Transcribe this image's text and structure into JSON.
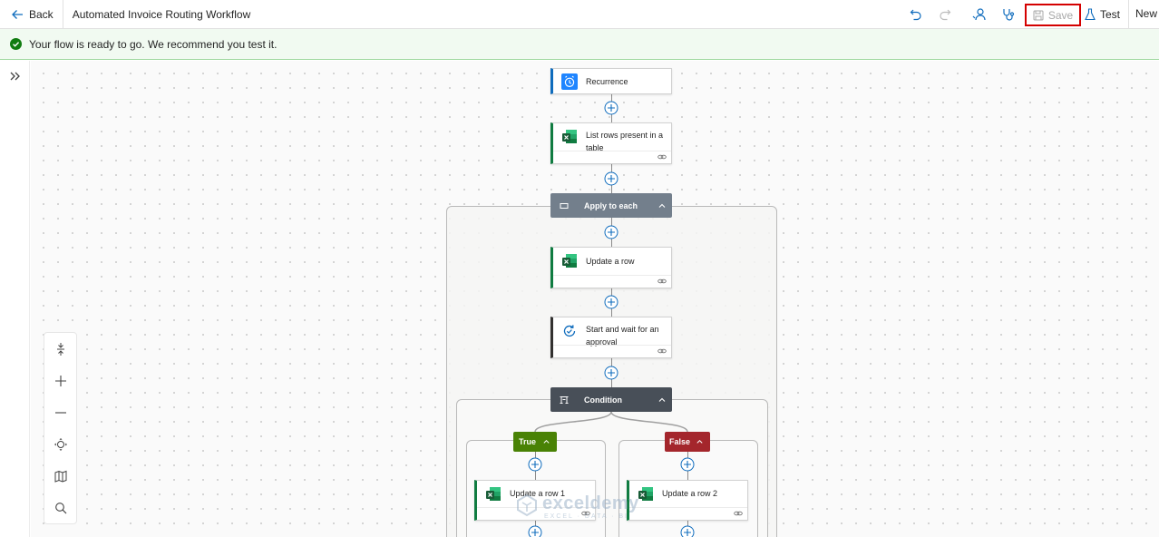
{
  "topbar": {
    "back_label": "Back",
    "flow_title": "Automated Invoice Routing Workflow",
    "save_label": "Save",
    "test_label": "Test",
    "new_label": "New",
    "icons": [
      "undo-icon",
      "redo-icon",
      "flow-checker-icon",
      "stethoscope-icon",
      "save-icon",
      "flask-icon"
    ]
  },
  "banner": {
    "message": "Your flow is ready to go. We recommend you test it.",
    "color": "#107c10"
  },
  "flow": {
    "trigger": {
      "title": "Recurrence",
      "accent": "#0f6cbd"
    },
    "list_rows": {
      "title": "List rows present in a table",
      "accent": "#107c41"
    },
    "apply_each": {
      "title": "Apply to each",
      "color": "#737f8c"
    },
    "update_row": {
      "title": "Update a row",
      "accent": "#107c41"
    },
    "approval": {
      "title": "Start and wait for an approval",
      "accent": "#323130"
    },
    "condition": {
      "title": "Condition",
      "color": "#484f58"
    },
    "true_branch": {
      "label": "True",
      "color": "#498205"
    },
    "false_branch": {
      "label": "False",
      "color": "#a4262c"
    },
    "update_row_1": {
      "title": "Update a row 1",
      "accent": "#107c41"
    },
    "update_row_2": {
      "title": "Update a row 2",
      "accent": "#107c41"
    }
  },
  "zoom_controls": [
    "fit-height-icon",
    "zoom-in-icon",
    "zoom-out-icon",
    "fit-view-icon",
    "minimap-icon",
    "search-icon"
  ],
  "watermark": {
    "name": "exceldemy",
    "sub": "EXCEL · DATA · BI"
  }
}
